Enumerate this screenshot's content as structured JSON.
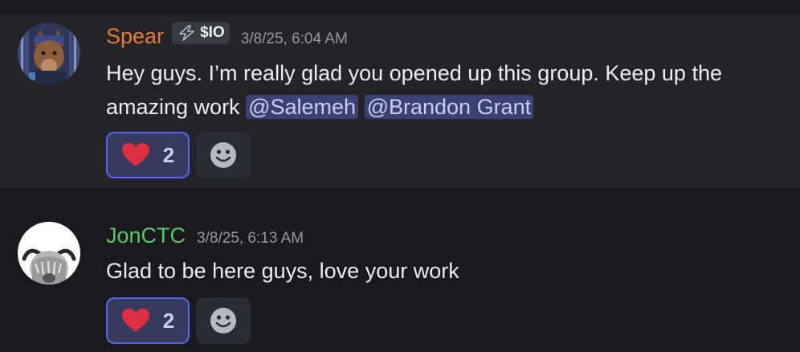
{
  "messages": [
    {
      "username": "Spear",
      "tag": "$IO",
      "timestamp": "3/8/25, 6:04 AM",
      "text_before": "Hey guys. I’m really glad you opened up this group. Keep up the amazing work ",
      "mentions": [
        "@Salemeh",
        "@Brandon Grant"
      ],
      "reaction": {
        "emoji": "heart-icon",
        "count": "2"
      },
      "username_color": "#e17d38"
    },
    {
      "username": "JonCTC",
      "timestamp": "3/8/25, 6:13 AM",
      "text": "Glad to be here guys, love your work",
      "reaction": {
        "emoji": "heart-icon",
        "count": "2"
      },
      "username_color": "#58c66b"
    }
  ],
  "colors": {
    "background": "#1a1a1e",
    "highlight_row": "#242428",
    "mention_bg": "#3c4270",
    "reaction_border": "#5865f2"
  }
}
